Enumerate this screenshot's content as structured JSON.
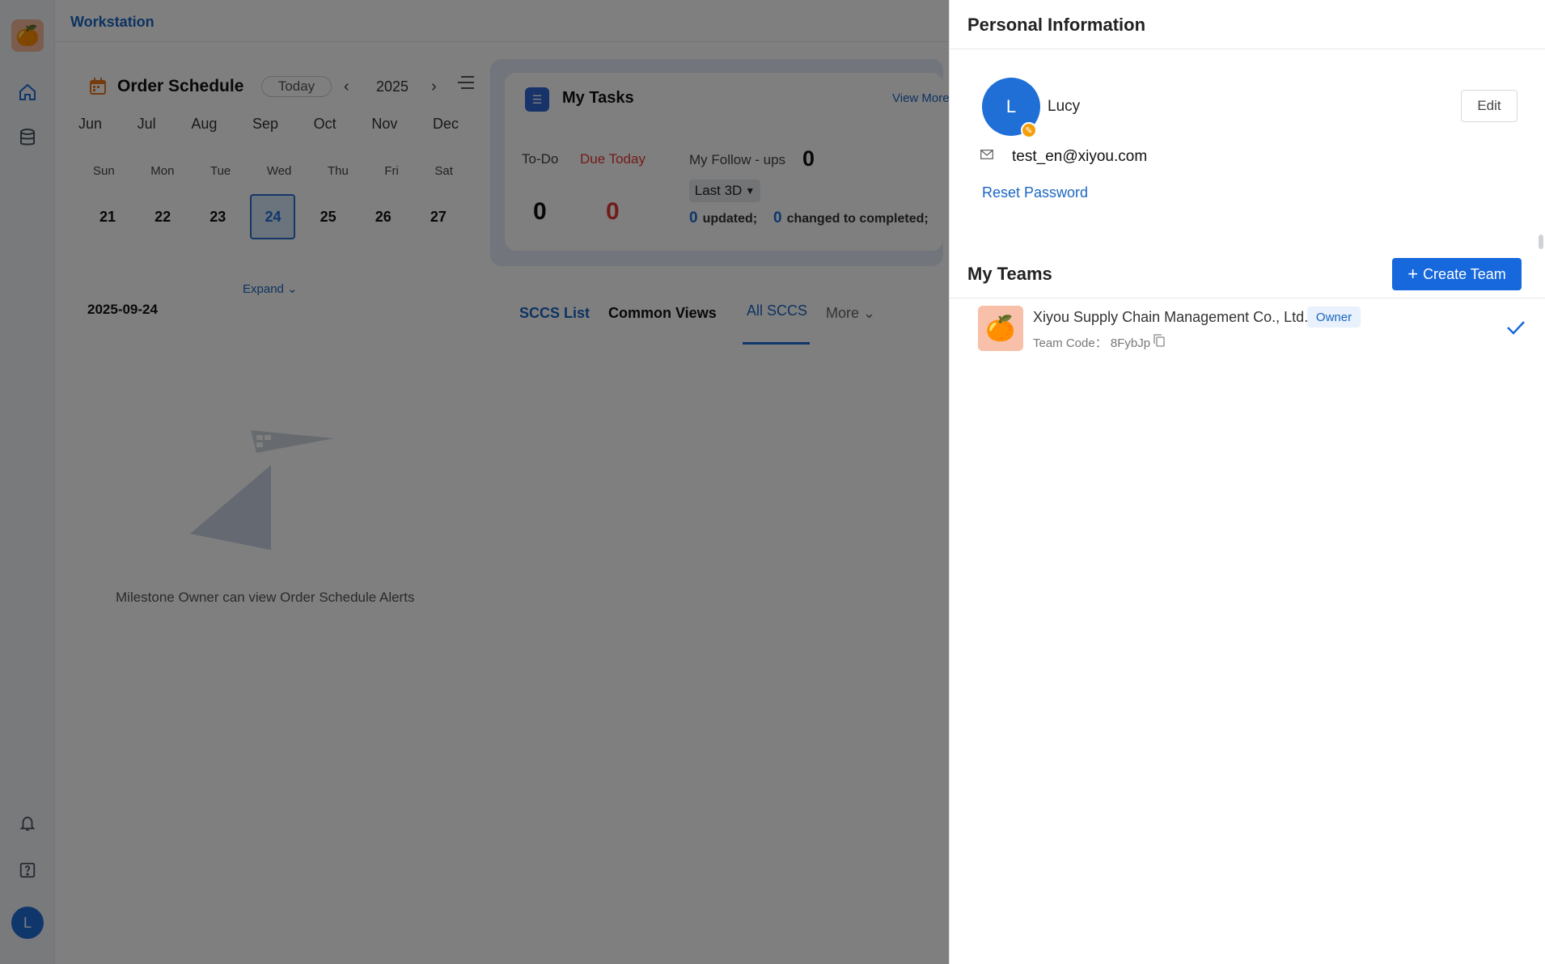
{
  "app": {
    "title": "Workstation"
  },
  "sidebar": {
    "avatar_initial": "L"
  },
  "schedule": {
    "title": "Order Schedule",
    "today_label": "Today",
    "year": "2025",
    "months": [
      "Jun",
      "Jul",
      "Aug",
      "Sep",
      "Oct",
      "Nov",
      "Dec"
    ],
    "weekdays": [
      "Sun",
      "Mon",
      "Tue",
      "Wed",
      "Thu",
      "Fri",
      "Sat"
    ],
    "dates": [
      "21",
      "22",
      "23",
      "24",
      "25",
      "26",
      "27"
    ],
    "selected_date": "24",
    "expand_label": "Expand",
    "current_date": "2025-09-24",
    "empty_text": "Milestone Owner can view Order Schedule Alerts"
  },
  "tasks": {
    "title": "My Tasks",
    "view_more": "View More",
    "todo_label": "To-Do",
    "todo_value": "0",
    "due_today_label": "Due Today",
    "due_today_value": "0",
    "followups_label": "My Follow - ups",
    "followups_value": "0",
    "range_label": "Last 3D",
    "updated_count": "0",
    "updated_label": "updated;",
    "completed_count": "0",
    "completed_label": "changed to completed;"
  },
  "views": {
    "tabs": [
      "SCCS List",
      "Common Views",
      "All SCCS",
      "More"
    ]
  },
  "drawer": {
    "title": "Personal Information",
    "avatar_initial": "L",
    "user_name": "Lucy",
    "edit_label": "Edit",
    "email": "test_en@xiyou.com",
    "reset_password": "Reset Password",
    "teams_title": "My Teams",
    "create_team": "Create Team",
    "team": {
      "name": "Xiyou Supply Chain Management Co., Ltd.",
      "role": "Owner",
      "code_label": "Team Code： 8FybJp"
    }
  },
  "colors": {
    "accent": "#1668dc",
    "due_today": "#e53935",
    "overlay": "rgba(0,0,0,0.5)"
  }
}
